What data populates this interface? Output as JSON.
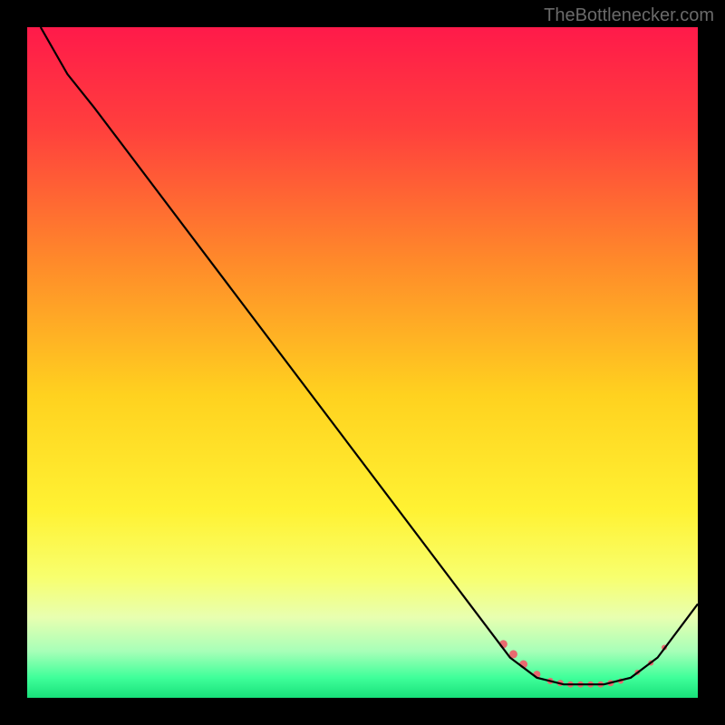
{
  "watermark": "TheBottlenecker.com",
  "chart_data": {
    "type": "line",
    "title": "",
    "xlabel": "",
    "ylabel": "",
    "xlim": [
      0,
      100
    ],
    "ylim": [
      0,
      100
    ],
    "gradient_stops": [
      {
        "offset": 0,
        "color": "#ff1a4a"
      },
      {
        "offset": 15,
        "color": "#ff3f3d"
      },
      {
        "offset": 35,
        "color": "#ff8a2a"
      },
      {
        "offset": 55,
        "color": "#ffd21f"
      },
      {
        "offset": 72,
        "color": "#fff233"
      },
      {
        "offset": 82,
        "color": "#f8ff6e"
      },
      {
        "offset": 88,
        "color": "#e8ffb0"
      },
      {
        "offset": 93,
        "color": "#a8ffb8"
      },
      {
        "offset": 97,
        "color": "#3fff9a"
      },
      {
        "offset": 100,
        "color": "#18e07a"
      }
    ],
    "series": [
      {
        "name": "curve",
        "color": "#000000",
        "points": [
          {
            "x": 2,
            "y": 100
          },
          {
            "x": 6,
            "y": 93
          },
          {
            "x": 10,
            "y": 88
          },
          {
            "x": 72,
            "y": 6
          },
          {
            "x": 76,
            "y": 3
          },
          {
            "x": 80,
            "y": 2
          },
          {
            "x": 86,
            "y": 2
          },
          {
            "x": 90,
            "y": 3
          },
          {
            "x": 94,
            "y": 6
          },
          {
            "x": 100,
            "y": 14
          }
        ]
      }
    ],
    "markers": {
      "color": "#e86a70",
      "points": [
        {
          "x": 71,
          "y": 8,
          "r": 4.5
        },
        {
          "x": 72.5,
          "y": 6.5,
          "r": 4.5
        },
        {
          "x": 74,
          "y": 5,
          "r": 4.5
        },
        {
          "x": 76,
          "y": 3.5,
          "r": 4
        },
        {
          "x": 78,
          "y": 2.5,
          "r": 3.5
        },
        {
          "x": 79.5,
          "y": 2.2,
          "r": 3.5
        },
        {
          "x": 81,
          "y": 2,
          "r": 3.5
        },
        {
          "x": 82.5,
          "y": 2,
          "r": 3.5
        },
        {
          "x": 84,
          "y": 2,
          "r": 3.5
        },
        {
          "x": 85.5,
          "y": 2,
          "r": 3.5
        },
        {
          "x": 87,
          "y": 2.2,
          "r": 3.5
        },
        {
          "x": 88.5,
          "y": 2.5,
          "r": 3
        },
        {
          "x": 91,
          "y": 3.8,
          "r": 3
        },
        {
          "x": 93,
          "y": 5.2,
          "r": 3
        },
        {
          "x": 95,
          "y": 7.5,
          "r": 3
        }
      ]
    }
  }
}
